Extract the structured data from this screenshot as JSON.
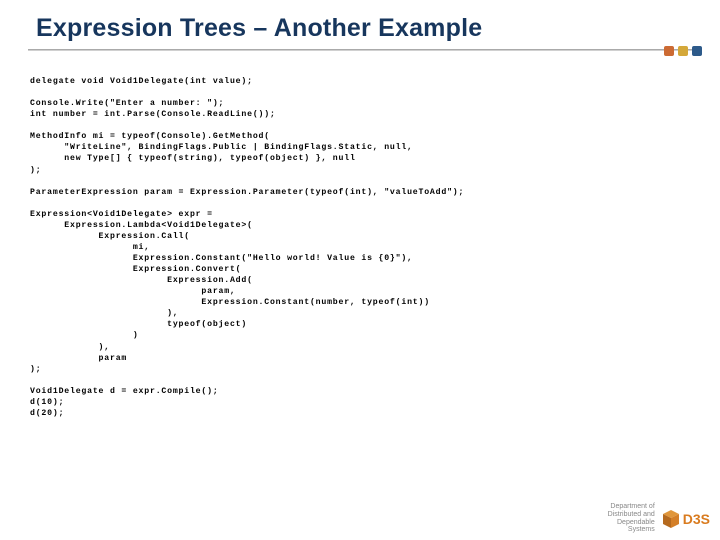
{
  "title": "Expression Trees – Another Example",
  "code": "delegate void Void1Delegate(int value);\n\nConsole.Write(\"Enter a number: \");\nint number = int.Parse(Console.ReadLine());\n\nMethodInfo mi = typeof(Console).GetMethod(\n      \"WriteLine\", BindingFlags.Public | BindingFlags.Static, null,\n      new Type[] { typeof(string), typeof(object) }, null\n);\n\nParameterExpression param = Expression.Parameter(typeof(int), \"valueToAdd\");\n\nExpression<Void1Delegate> expr =\n      Expression.Lambda<Void1Delegate>(\n            Expression.Call(\n                  mi,\n                  Expression.Constant(\"Hello world! Value is {0}\"),\n                  Expression.Convert(\n                        Expression.Add(\n                              param,\n                              Expression.Constant(number, typeof(int))\n                        ),\n                        typeof(object)\n                  )\n            ),\n            param\n);\n\nVoid1Delegate d = expr.Compile();\nd(10);\nd(20);",
  "footer": {
    "line1": "Department of",
    "line2": "Distributed and",
    "line3": "Dependable",
    "line4": "Systems",
    "logo": "D3S"
  }
}
